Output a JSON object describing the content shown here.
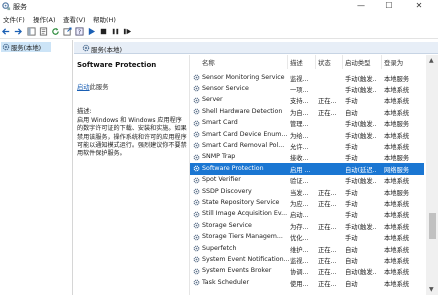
{
  "window": {
    "title": "服务"
  },
  "menu": [
    "文件(F)",
    "操作(A)",
    "查看(V)",
    "帮助(H)"
  ],
  "tree": {
    "root_label": "服务(本地)"
  },
  "pane": {
    "header": "服务(本地)"
  },
  "detail": {
    "title": "Software Protection",
    "link_text": "启动",
    "link_suffix": "此服务",
    "desc_label": "描述:",
    "description": "启用 Windows 和 Windows 应用程序的数字许可证的下载、安装和实施。如果禁用该服务，操作系统和许可的应用程序可能以通知模式运行。强烈建议你不要禁用软件保护服务。"
  },
  "columns": [
    "名称",
    "描述",
    "状态",
    "启动类型",
    "登录为"
  ],
  "services": [
    {
      "name": "Sensor Monitoring Service",
      "desc": "监视...",
      "status": "",
      "startup": "手动(触发...",
      "logon": "本地服务"
    },
    {
      "name": "Sensor Service",
      "desc": "一项...",
      "status": "",
      "startup": "手动(触发...",
      "logon": "本地系统"
    },
    {
      "name": "Server",
      "desc": "支持...",
      "status": "正在...",
      "startup": "手动",
      "logon": "本地系统"
    },
    {
      "name": "Shell Hardware Detection",
      "desc": "为自...",
      "status": "正在...",
      "startup": "自动",
      "logon": "本地系统"
    },
    {
      "name": "Smart Card",
      "desc": "管理...",
      "status": "",
      "startup": "手动(触发...",
      "logon": "本地服务"
    },
    {
      "name": "Smart Card Device Enum...",
      "desc": "为给...",
      "status": "",
      "startup": "手动(触发...",
      "logon": "本地系统"
    },
    {
      "name": "Smart Card Removal Pol...",
      "desc": "允许...",
      "status": "",
      "startup": "手动",
      "logon": "本地系统"
    },
    {
      "name": "SNMP Trap",
      "desc": "接收...",
      "status": "",
      "startup": "手动",
      "logon": "本地服务"
    },
    {
      "name": "Software Protection",
      "desc": "启用 ...",
      "status": "",
      "startup": "自动(延迟...",
      "logon": "网络服务"
    },
    {
      "name": "Spot Verifier",
      "desc": "验证...",
      "status": "",
      "startup": "手动(触发...",
      "logon": "本地系统"
    },
    {
      "name": "SSDP Discovery",
      "desc": "当发...",
      "status": "正在...",
      "startup": "手动",
      "logon": "本地服务"
    },
    {
      "name": "State Repository Service",
      "desc": "为应...",
      "status": "正在...",
      "startup": "手动",
      "logon": "本地系统"
    },
    {
      "name": "Still Image Acquisition Ev...",
      "desc": "启动...",
      "status": "",
      "startup": "手动",
      "logon": "本地系统"
    },
    {
      "name": "Storage Service",
      "desc": "为存...",
      "status": "正在...",
      "startup": "手动(触发...",
      "logon": "本地系统"
    },
    {
      "name": "Storage Tiers Managem...",
      "desc": "优化...",
      "status": "",
      "startup": "手动",
      "logon": "本地系统"
    },
    {
      "name": "Superfetch",
      "desc": "维护...",
      "status": "正在...",
      "startup": "自动",
      "logon": "本地系统"
    },
    {
      "name": "System Event Notification...",
      "desc": "监视...",
      "status": "正在...",
      "startup": "自动",
      "logon": "本地系统"
    },
    {
      "name": "System Events Broker",
      "desc": "协调...",
      "status": "正在...",
      "startup": "自动(触发...",
      "logon": "本地系统"
    },
    {
      "name": "Task Scheduler",
      "desc": "使用...",
      "status": "正在...",
      "startup": "自动",
      "logon": "本地系统"
    }
  ],
  "selected_index": 8,
  "colors": {
    "selection": "#1a76d2",
    "header": "#e7eef7",
    "tree_selection": "#cce4f7"
  },
  "icons": [
    "services-app-icon",
    "minimize-icon",
    "maximize-icon",
    "close-icon",
    "back-arrow-icon",
    "forward-arrow-icon",
    "console-icon",
    "properties-icon",
    "refresh-icon",
    "export-icon",
    "help-icon",
    "play-icon",
    "stop-icon",
    "pause-icon",
    "restart-icon",
    "gear-icon"
  ]
}
